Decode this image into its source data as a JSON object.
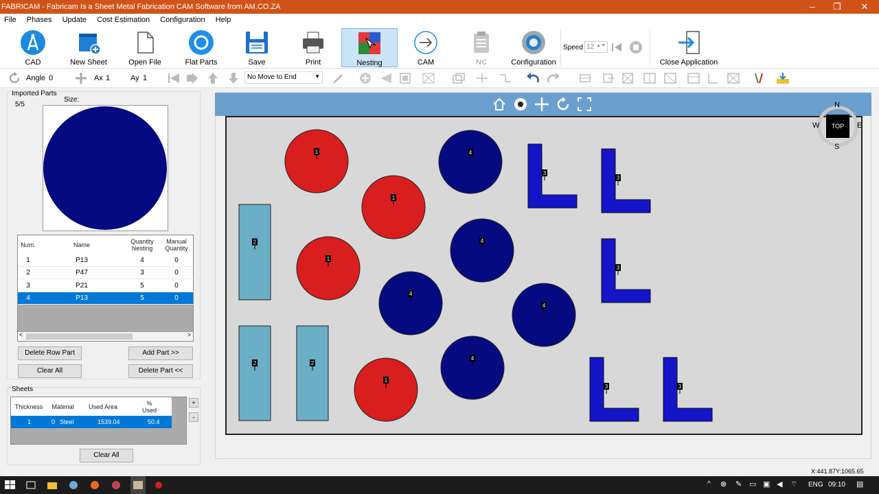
{
  "window": {
    "title": "FABRICAM - Fabricam Is a Sheet Metal Fabrication CAM Software from AM.CO.ZA",
    "controls": [
      "–",
      "❐",
      "✕"
    ]
  },
  "menu": [
    "File",
    "Phases",
    "Update",
    "Cost Estimation",
    "Configuration",
    "Help"
  ],
  "ribbon": {
    "buttons": [
      {
        "label": "CAD",
        "icon": "compass-icon"
      },
      {
        "label": "New Sheet",
        "icon": "new-sheet-icon"
      },
      {
        "label": "Open File",
        "icon": "open-file-icon"
      },
      {
        "label": "Flat Parts",
        "icon": "flat-parts-icon"
      },
      {
        "label": "Save",
        "icon": "save-icon"
      },
      {
        "label": "Print",
        "icon": "printer-icon"
      },
      {
        "label": "Nesting",
        "icon": "nesting-icon"
      },
      {
        "label": "CAM",
        "icon": "cam-arrow-icon"
      },
      {
        "label": "NC",
        "icon": "nc-clipboard-icon"
      },
      {
        "label": "Configuration",
        "icon": "configuration-gear-icon"
      },
      {
        "label": "Close Application",
        "icon": "close-application-icon"
      }
    ],
    "speed_label": "Speed",
    "speed_value": "12"
  },
  "toolbar": {
    "angle_label": "Angle",
    "angle_value": "0",
    "ax_label": "Ax",
    "ax_value": "1",
    "ay_label": "Ay",
    "ay_value": "1",
    "move_select": "No Move to End"
  },
  "imported_parts": {
    "title": "Imported Parts",
    "count": "5/5",
    "size_label": "Size:",
    "columns": [
      "Num.",
      "Name",
      "Quantity Nesting",
      "Manual Quantity"
    ],
    "rows": [
      [
        "1",
        "P13",
        "4",
        "0"
      ],
      [
        "2",
        "P47",
        "3",
        "0"
      ],
      [
        "3",
        "P21",
        "5",
        "0"
      ],
      [
        "4",
        "P13",
        "5",
        "0"
      ]
    ],
    "selected_row": 3,
    "buttons": {
      "delete_row": "Delete Row Part",
      "add_part": "Add Part >>",
      "clear_all": "Clear All",
      "delete_part": "Delete Part <<"
    }
  },
  "sheets": {
    "title": "Sheets",
    "columns": [
      "Thickness",
      "Material",
      "Used Area",
      "% Used"
    ],
    "rows": [
      [
        "1",
        "0",
        "Steel",
        "1539.04",
        "50.4"
      ]
    ],
    "add": "+",
    "remove": "-",
    "clear_all": "Clear All"
  },
  "canvas": {
    "compass": {
      "n": "N",
      "s": "S",
      "e": "E",
      "w": "W",
      "view": "TOP"
    },
    "parts": {
      "red_circle_label": "1",
      "light_rect_label": "2",
      "l_shape_label": "3",
      "navy_circle_label": "4"
    },
    "colors": {
      "sheet": "#d8d8d8",
      "red": "#d91e1e",
      "navy": "#050a80",
      "blue_l": "#1414c8",
      "teal": "#6aafc6"
    }
  },
  "status": {
    "coords": "X:441.87Y:1065.65"
  },
  "taskbar": {
    "lang": "ENG",
    "time": "09:10"
  }
}
